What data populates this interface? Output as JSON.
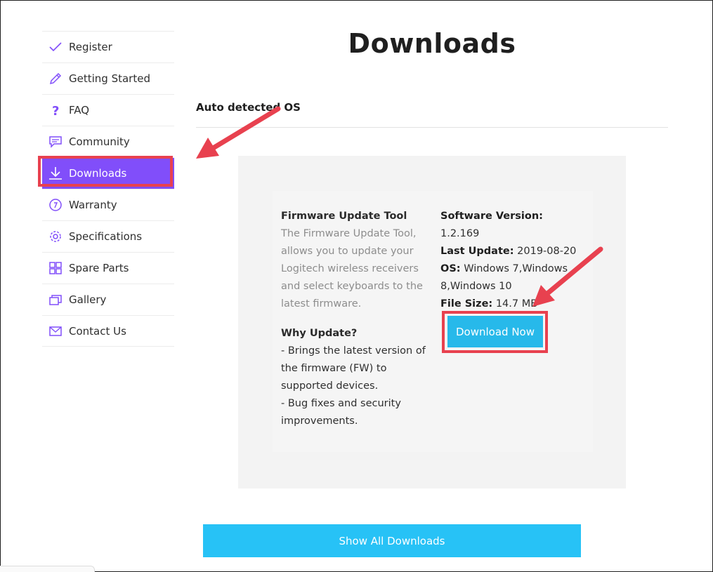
{
  "sidebar": {
    "items": [
      {
        "label": "Register",
        "icon": "checkmark-icon"
      },
      {
        "label": "Getting Started",
        "icon": "pencil-icon"
      },
      {
        "label": "FAQ",
        "icon": "question-mark-icon"
      },
      {
        "label": "Community",
        "icon": "chat-bubble-icon"
      },
      {
        "label": "Downloads",
        "icon": "download-icon",
        "active": true
      },
      {
        "label": "Warranty",
        "icon": "warranty-icon"
      },
      {
        "label": "Specifications",
        "icon": "gear-icon"
      },
      {
        "label": "Spare Parts",
        "icon": "grid-icon"
      },
      {
        "label": "Gallery",
        "icon": "gallery-icon"
      },
      {
        "label": "Contact Us",
        "icon": "envelope-icon"
      }
    ]
  },
  "main": {
    "title": "Downloads",
    "os_label": "Auto detected OS",
    "tool": {
      "name": "Firmware Update Tool",
      "description": [
        "The Firmware Update Tool,",
        "allows you to update your",
        "Logitech wireless receivers",
        "and select keyboards to the",
        "latest firmware."
      ],
      "why_heading": "Why Update?",
      "why_lines": [
        "- Brings the latest version of",
        "the firmware (FW) to",
        "supported devices.",
        "- Bug fixes and security",
        "improvements."
      ]
    },
    "details": {
      "version_label": "Software Version:",
      "version_value": "1.2.169",
      "updated_label": "Last Update:",
      "updated_value": "2019-08-20",
      "os_label": "OS:",
      "os_value_1": "Windows 7,Windows",
      "os_value_2": "8,Windows 10",
      "size_label": "File Size:",
      "size_value": "14.7 MB"
    },
    "download_button": "Download Now",
    "show_all_button": "Show All Downloads"
  },
  "colors": {
    "accent_purple": "#814efa",
    "button_blue": "#27b9ea",
    "highlight_red": "#e8414f"
  }
}
